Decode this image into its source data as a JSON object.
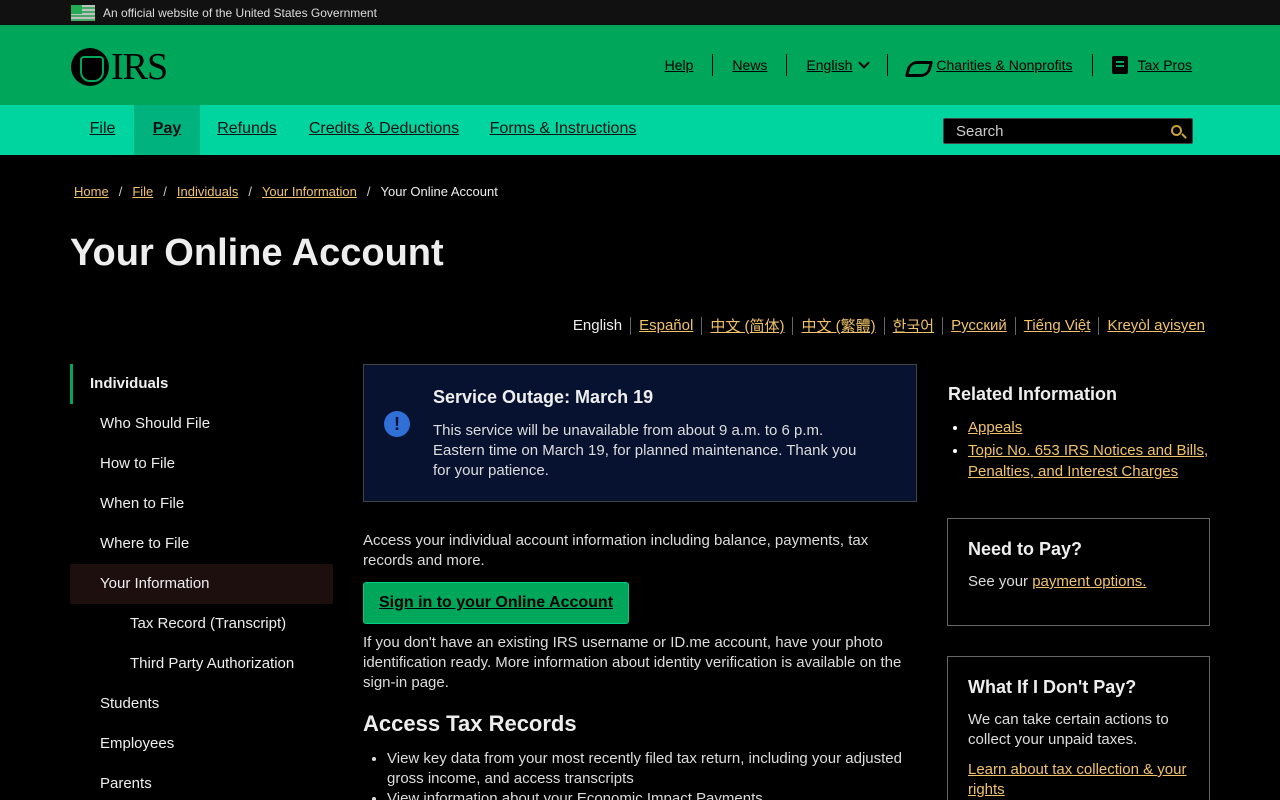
{
  "gov_banner": {
    "text": "An official website of the United States Government"
  },
  "header": {
    "logo_text": "IRS",
    "util": {
      "help": "Help",
      "news": "News",
      "language": "English",
      "charities": "Charities & Nonprofits",
      "tax_pros": "Tax Pros"
    }
  },
  "nav": {
    "tabs": [
      {
        "label": "File"
      },
      {
        "label": "Pay"
      },
      {
        "label": "Refunds"
      },
      {
        "label": "Credits & Deductions"
      },
      {
        "label": "Forms & Instructions"
      }
    ],
    "search_placeholder": "Search"
  },
  "breadcrumb": {
    "items": [
      "Home",
      "File",
      "Individuals",
      "Your Information"
    ],
    "current": "Your Online Account"
  },
  "page": {
    "title": "Your Online Account"
  },
  "languages": {
    "current": "English",
    "links": [
      "Español",
      "中文 (简体)",
      "中文 (繁體)",
      "한국어",
      "Русский",
      "Tiếng Việt",
      "Kreyòl ayisyen"
    ]
  },
  "sidebar": {
    "items": [
      {
        "label": "Individuals"
      },
      {
        "label": "Who Should File"
      },
      {
        "label": "How to File"
      },
      {
        "label": "When to File"
      },
      {
        "label": "Where to File"
      },
      {
        "label": "Your Information"
      },
      {
        "label": "Tax Record (Transcript)"
      },
      {
        "label": "Third Party Authorization"
      },
      {
        "label": "Students"
      },
      {
        "label": "Employees"
      },
      {
        "label": "Parents"
      }
    ]
  },
  "alert": {
    "icon_glyph": "!",
    "title": "Service Outage: March 19",
    "body": "This service will be unavailable from about 9 a.m. to 6 p.m. Eastern time on March 19, for planned maintenance. Thank you for your patience."
  },
  "content": {
    "intro": "Access your individual account information including balance, payments, tax records and more.",
    "signin_label": "Sign in to your Online Account",
    "id_note": "If you don't have an existing IRS username or ID.me account, have your photo identification ready. More information about identity verification is available on the sign-in page.",
    "section_title": "Access Tax Records",
    "bullets": [
      "View key data from your most recently filed tax return, including your adjusted gross income, and access transcripts",
      "View information about your Economic Impact Payments"
    ]
  },
  "related": {
    "title": "Related Information",
    "links": [
      "Appeals",
      "Topic No. 653 IRS Notices and Bills, Penalties, and Interest Charges"
    ]
  },
  "need_to_pay": {
    "title": "Need to Pay?",
    "prefix": "See your ",
    "link": "payment options."
  },
  "dont_pay": {
    "title": "What If I Don't Pay?",
    "body": "We can take certain actions to collect your unpaid taxes.",
    "link": "Learn about tax collection & your rights"
  }
}
